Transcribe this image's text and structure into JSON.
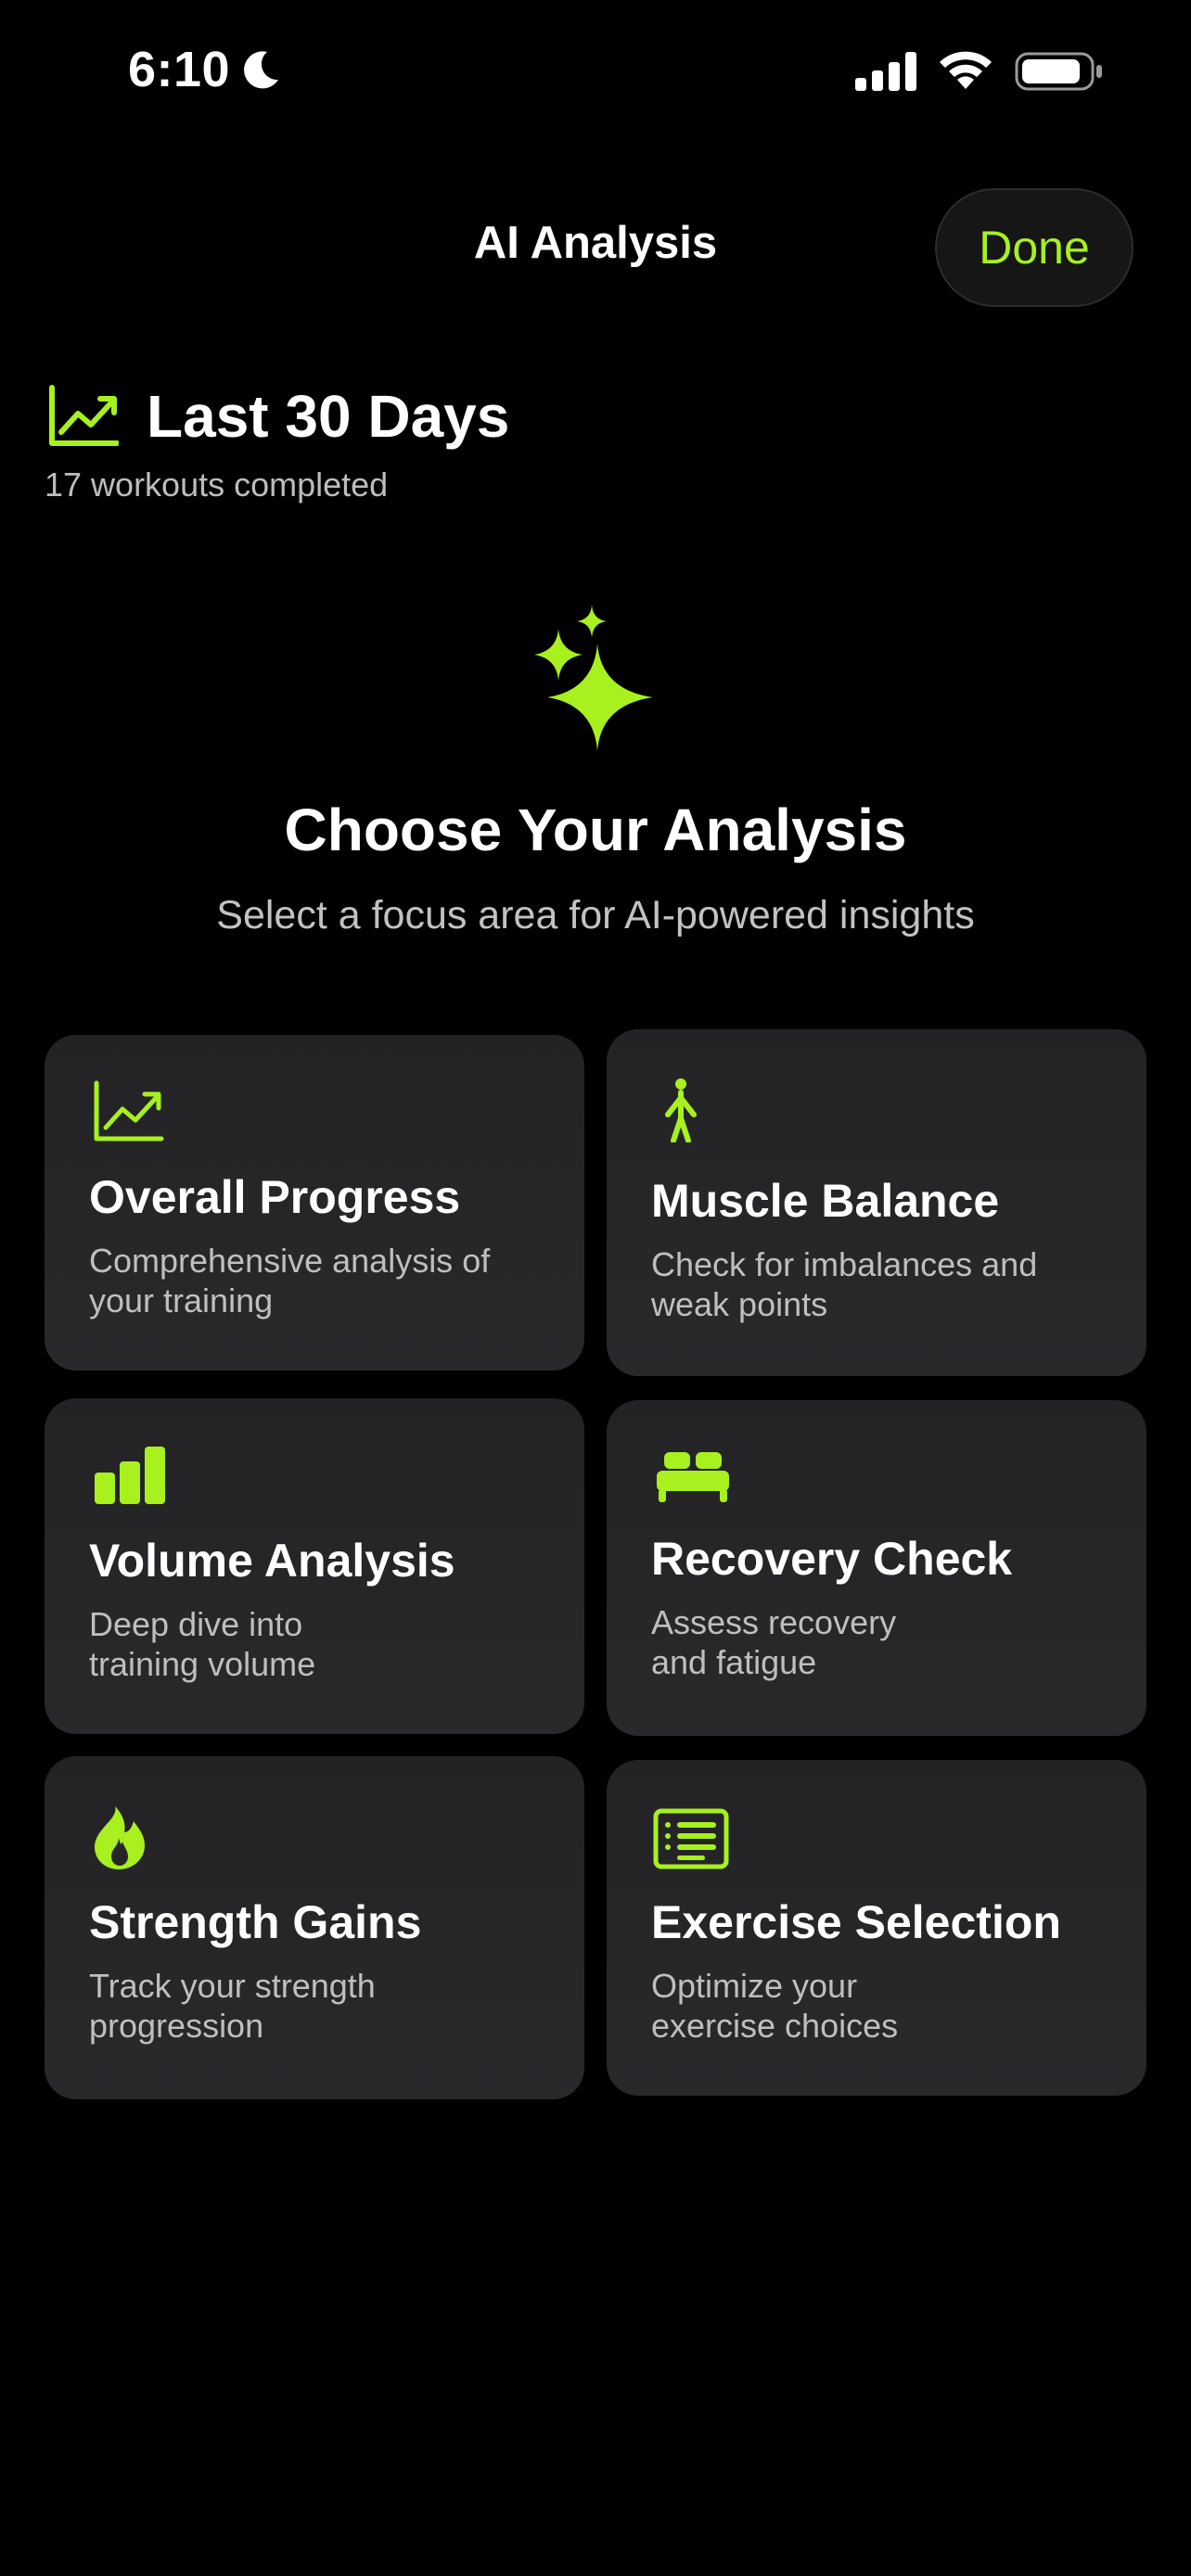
{
  "status_bar": {
    "time": "6:10",
    "icons": [
      "moon-icon",
      "signal-icon",
      "wifi-icon",
      "battery-icon"
    ]
  },
  "header": {
    "title": "AI Analysis",
    "done_label": "Done"
  },
  "period": {
    "icon": "chart-line-uptrend-icon",
    "title": "Last 30 Days",
    "subtitle": "17 workouts completed"
  },
  "hero": {
    "icon": "sparkles-icon",
    "title": "Choose Your Analysis",
    "subtitle": "Select a focus area for AI-powered insights"
  },
  "cards": [
    {
      "icon": "chart-line-uptrend-icon",
      "title": "Overall Progress",
      "description": "Comprehensive analysis of your training"
    },
    {
      "icon": "figure-standing-icon",
      "title": "Muscle Balance",
      "description": "Check for imbalances and weak points"
    },
    {
      "icon": "bar-chart-icon",
      "title": "Volume Analysis",
      "description": "Deep dive into training volume"
    },
    {
      "icon": "bed-icon",
      "title": "Recovery Check",
      "description": "Assess recovery and fatigue"
    },
    {
      "icon": "flame-icon",
      "title": "Strength Gains",
      "description": "Track your strength progression"
    },
    {
      "icon": "list-clipboard-icon",
      "title": "Exercise Selection",
      "description": "Optimize your exercise choices"
    }
  ],
  "colors": {
    "accent": "#a8f01e",
    "background": "#000000",
    "card": "#262628",
    "secondary_text": "#bfbfbf"
  }
}
